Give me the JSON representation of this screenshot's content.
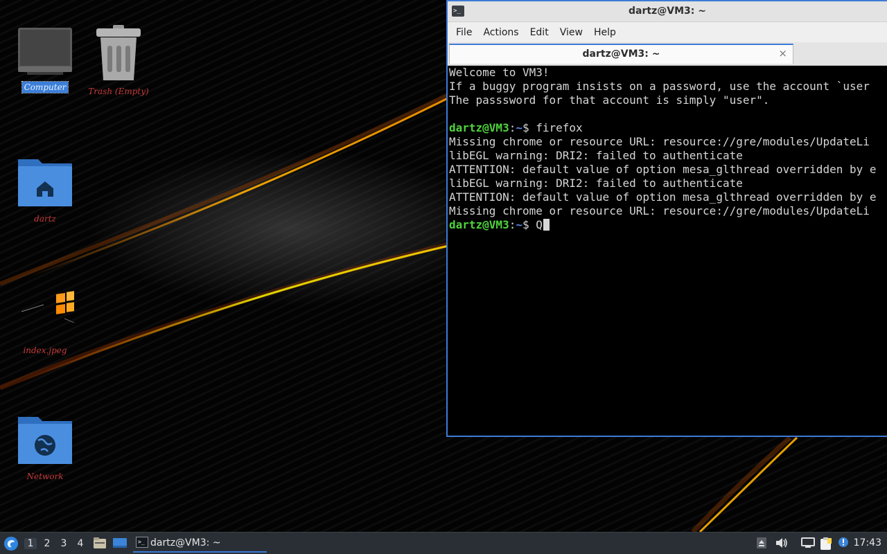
{
  "desktop": {
    "icons": [
      {
        "label": "Computer"
      },
      {
        "label": "Trash (Empty)"
      },
      {
        "label": "dartz"
      },
      {
        "label": "index.jpeg"
      },
      {
        "label": "Network"
      }
    ]
  },
  "terminal": {
    "window_title": "dartz@VM3: ~",
    "title_icon": ">_",
    "menu": [
      "File",
      "Actions",
      "Edit",
      "View",
      "Help"
    ],
    "tab_title": "dartz@VM3: ~",
    "tab_close": "×",
    "lines": [
      "Welcome to VM3!",
      "If a buggy program insists on a password, use the account `user",
      "The passsword for that account is simply \"user\".",
      "",
      "",
      "Missing chrome or resource URL: resource://gre/modules/UpdateLi",
      "libEGL warning: DRI2: failed to authenticate",
      "ATTENTION: default value of option mesa_glthread overridden by e",
      "libEGL warning: DRI2: failed to authenticate",
      "ATTENTION: default value of option mesa_glthread overridden by e",
      "Missing chrome or resource URL: resource://gre/modules/UpdateLi"
    ],
    "prompt_user": "dartz@VM3",
    "prompt_sep": ":",
    "prompt_path": "~",
    "prompt_symbol": "$ ",
    "commands": [
      "firefox",
      "Q"
    ]
  },
  "taskbar": {
    "workspaces": [
      "1",
      "2",
      "3",
      "4"
    ],
    "active_workspace": "1",
    "task_label": "dartz@VM3: ~",
    "task_icon": ">_",
    "clock": "17:43",
    "icons": [
      "start-menu-icon",
      "file-manager-icon",
      "show-desktop-icon",
      "terminal-icon",
      "tray-up-arrow-icon",
      "volume-icon",
      "network-icon",
      "clipboard-icon",
      "update-notifier-icon"
    ]
  },
  "colors": {
    "accent": "#3d7bd6",
    "prompt_user": "#4ed33b",
    "prompt_path": "#5a83e0",
    "desktop_label": "#c83a3a"
  }
}
